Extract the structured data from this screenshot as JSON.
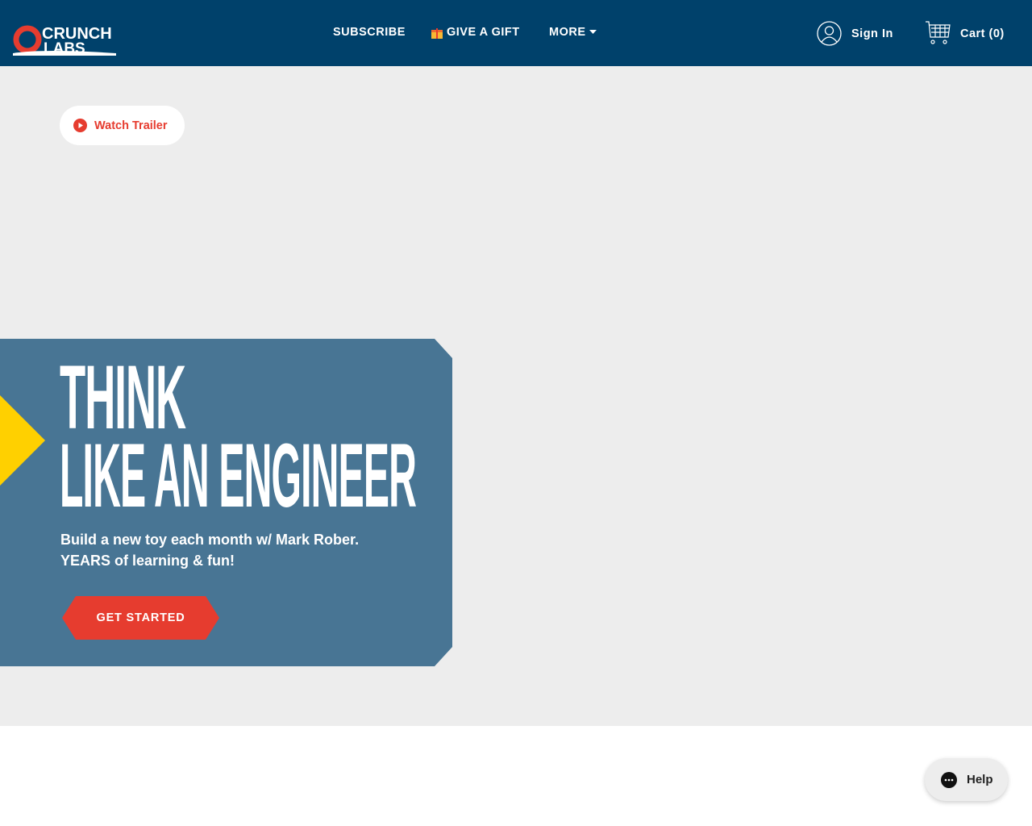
{
  "header": {
    "logo_text": [
      "CRUNCH",
      "LABS"
    ],
    "nav": [
      {
        "label": "SUBSCRIBE"
      },
      {
        "label": "GIVE A GIFT",
        "icon": "gift-icon"
      },
      {
        "label": "MORE",
        "icon": "caret-down-icon"
      }
    ],
    "sign_in": "Sign In",
    "cart": "Cart (0)"
  },
  "hero": {
    "watch_trailer": "Watch Trailer",
    "headline_line1": "THINK",
    "headline_line2": "LIKE AN ENGINEER",
    "subtext_line1": "Build a new toy each month w/ Mark Rober.",
    "subtext_line2": "YEARS of learning & fun!",
    "cta": "GET STARTED"
  },
  "help": {
    "label": "Help"
  },
  "colors": {
    "header": "#00416b",
    "panel": "#487594",
    "accent": "#e63c2f",
    "yellow": "#ffd000",
    "hero_bg": "#ededed"
  }
}
